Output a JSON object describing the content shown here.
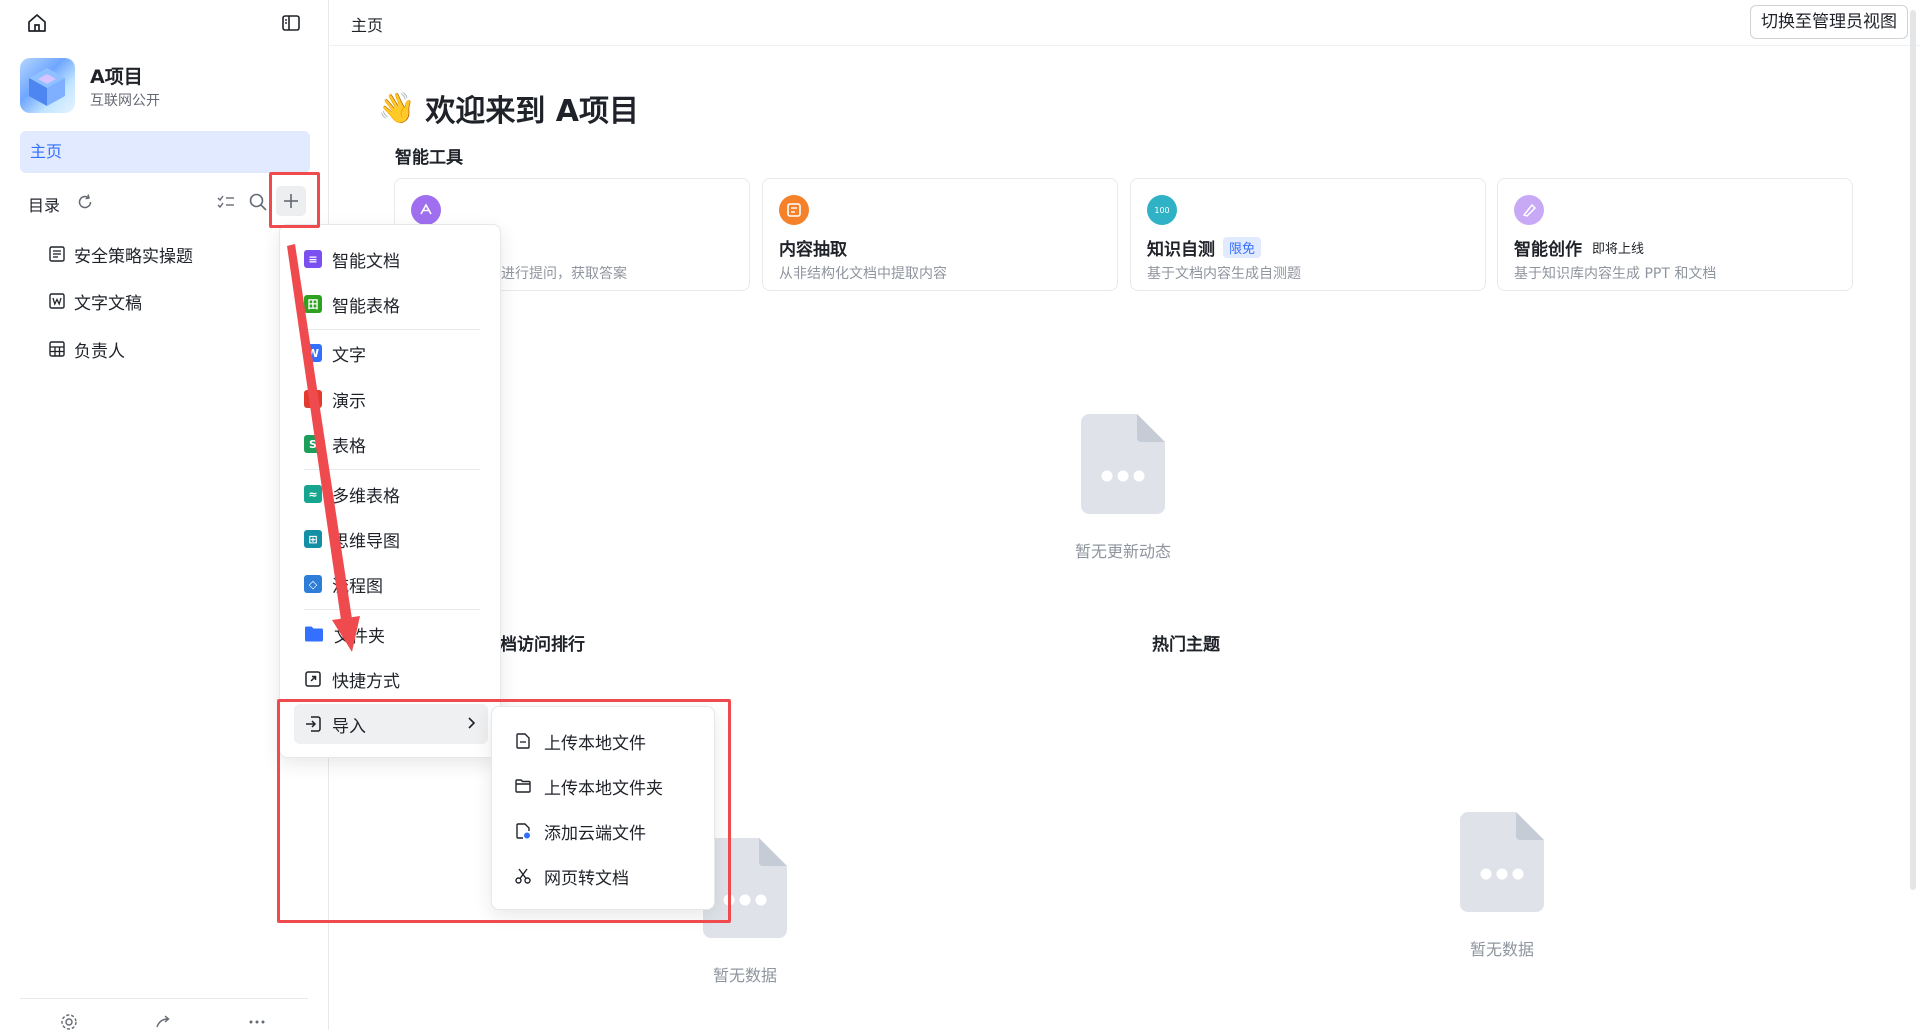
{
  "sidebar": {
    "project_name": "A项目",
    "project_sub": "互联网公开",
    "nav_home": "主页",
    "catalog_label": "目录",
    "tree": [
      {
        "label": "安全策略实操题",
        "icon": "doc-icon"
      },
      {
        "label": "文字文稿",
        "icon": "word-icon"
      },
      {
        "label": "负责人",
        "icon": "table-icon"
      }
    ]
  },
  "header": {
    "breadcrumb": "主页",
    "admin_button": "切换至管理员视图"
  },
  "main": {
    "welcome_emoji": "👋",
    "welcome": "欢迎来到 A项目",
    "tools_title": "智能工具",
    "tools": [
      {
        "name": "",
        "desc": "进行提问，获取答案",
        "color": "#9f6ff0"
      },
      {
        "name": "内容抽取",
        "desc": "从非结构化文档中提取内容",
        "color": "#f5822a"
      },
      {
        "name": "知识自测",
        "tag": "限免",
        "desc": "基于文档内容生成自测题",
        "color": "#2fb1c6"
      },
      {
        "name": "智能创作",
        "tag": "即将上线",
        "desc": "基于知识库内容生成 PPT 和文档",
        "color": "#c8a9f5"
      }
    ],
    "empty_updates": "暂无更新动态",
    "rank_title": "档访问排行",
    "hot_title": "热门主题",
    "empty_data": "暂无数据"
  },
  "menu": {
    "items": [
      {
        "label": "智能文档",
        "color": "#7b4ff0",
        "glyph": "≡"
      },
      {
        "label": "智能表格",
        "color": "#2ea121",
        "glyph": "田"
      },
      {
        "label": "文字",
        "color": "#3370ff",
        "glyph": "W"
      },
      {
        "label": "演示",
        "color": "#e33b2f",
        "glyph": "P"
      },
      {
        "label": "表格",
        "color": "#1e9e5b",
        "glyph": "S"
      },
      {
        "label": "多维表格",
        "color": "#17a58f",
        "glyph": "≈"
      },
      {
        "label": "思维导图",
        "color": "#138fa6",
        "glyph": "⊞"
      },
      {
        "label": "流程图",
        "color": "#2e7ed9",
        "glyph": "◇"
      },
      {
        "label": "文件夹",
        "color": "#3370ff",
        "glyph": ""
      },
      {
        "label": "快捷方式",
        "color": "#1f2329",
        "glyph": "↗"
      },
      {
        "label": "导入",
        "color": "#1f2329",
        "glyph": ""
      }
    ],
    "submenu": [
      {
        "label": "上传本地文件"
      },
      {
        "label": "上传本地文件夹"
      },
      {
        "label": "添加云端文件"
      },
      {
        "label": "网页转文档"
      }
    ]
  }
}
